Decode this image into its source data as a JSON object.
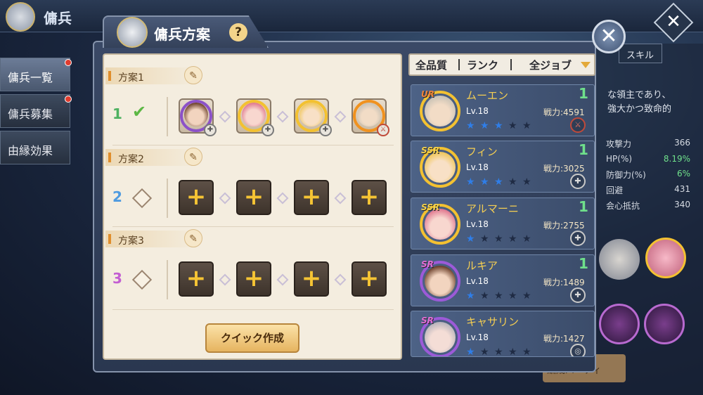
{
  "header": {
    "title": "傭兵"
  },
  "left_tabs": [
    {
      "label": "傭兵一覧"
    },
    {
      "label": "傭兵募集"
    },
    {
      "label": "由縁効果"
    }
  ],
  "background": {
    "tab_skill": "スキル",
    "desc": [
      "な領主であり、",
      "強大かつ致命的"
    ],
    "stats": [
      {
        "label": "攻撃力",
        "value": "366"
      },
      {
        "label": "HP(%)",
        "value": "8.19%"
      },
      {
        "label": "防御力(%)",
        "value": "6%"
      },
      {
        "label": "回避",
        "value": "431"
      },
      {
        "label": "会心抵抗",
        "value": "340"
      }
    ],
    "bottom_btn": "編成パーティ"
  },
  "dialog": {
    "title": "傭兵方案",
    "help": "?",
    "close": "✕"
  },
  "presets": [
    {
      "name": "方案1",
      "number": "1",
      "selected": true
    },
    {
      "name": "方案2",
      "number": "2",
      "selected": false
    },
    {
      "name": "方案3",
      "number": "3",
      "selected": false
    }
  ],
  "quick_button": "クイック作成",
  "filters": {
    "quality": "全品質",
    "rank": "ランク",
    "job": "全ジョブ"
  },
  "heroes": [
    {
      "rarity": "UR",
      "name": "ムーエン",
      "level": "Lv.18",
      "power": "戦力:4591",
      "count": "1",
      "stars": 3,
      "max_stars": 5
    },
    {
      "rarity": "SSR",
      "name": "フィン",
      "level": "Lv.18",
      "power": "戦力:3025",
      "count": "1",
      "stars": 3,
      "max_stars": 5
    },
    {
      "rarity": "SSR",
      "name": "アルマーニ",
      "level": "Lv.18",
      "power": "戦力:2755",
      "count": "1",
      "stars": 1,
      "max_stars": 5
    },
    {
      "rarity": "SR",
      "name": "ルキア",
      "level": "Lv.18",
      "power": "戦力:1489",
      "count": "1",
      "stars": 1,
      "max_stars": 5
    },
    {
      "rarity": "SR",
      "name": "キャサリン",
      "level": "Lv.18",
      "power": "戦力:1427",
      "count": "",
      "stars": 1,
      "max_stars": 5
    }
  ],
  "colors": {
    "accent_gold": "#f3c131",
    "star_blue": "#2f7ee8",
    "star_dark": "#1f2b44",
    "count_green": "#6fe08b"
  }
}
